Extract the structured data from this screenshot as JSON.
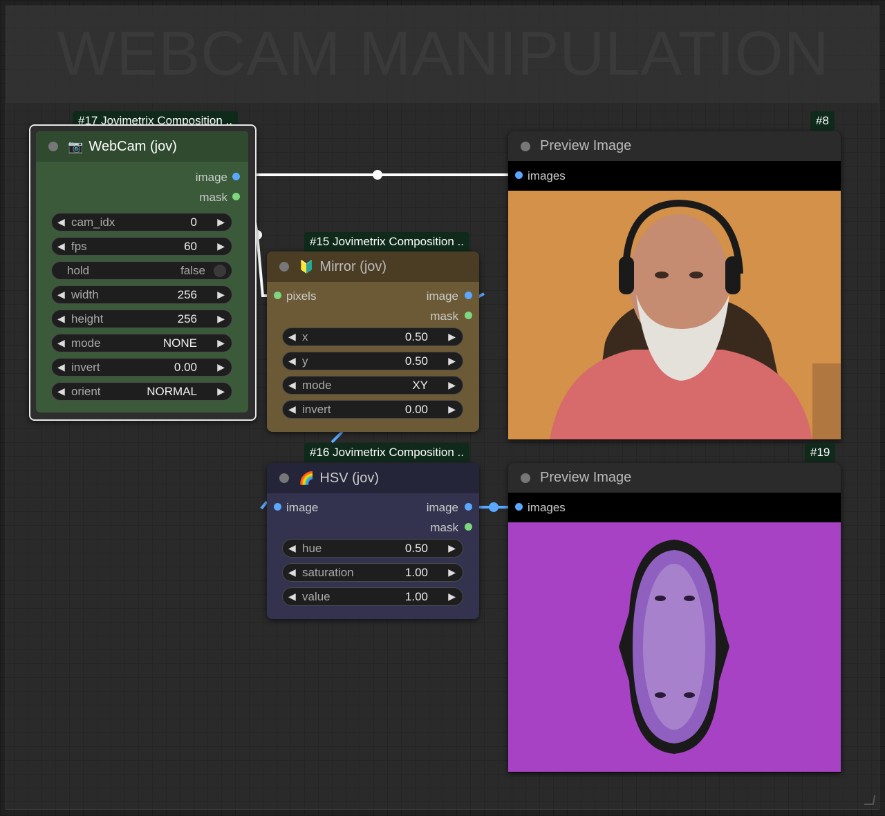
{
  "group": {
    "title": "WEBCAM MANIPULATION"
  },
  "nodes": {
    "webcam": {
      "badge": "#17 Jovimetrix Composition ..",
      "title": "WebCam (jov)",
      "icon": "camera-icon",
      "outputs": [
        "image",
        "mask"
      ],
      "widgets": [
        {
          "label": "cam_idx",
          "value": "0"
        },
        {
          "label": "fps",
          "value": "60"
        },
        {
          "label": "hold",
          "value": "false",
          "toggle": true
        },
        {
          "label": "width",
          "value": "256"
        },
        {
          "label": "height",
          "value": "256"
        },
        {
          "label": "mode",
          "value": "NONE"
        },
        {
          "label": "invert",
          "value": "0.00"
        },
        {
          "label": "orient",
          "value": "NORMAL"
        }
      ]
    },
    "mirror": {
      "badge": "#15 Jovimetrix Composition ..",
      "title": "Mirror (jov)",
      "icon": "beginner-badge-icon",
      "input": "pixels",
      "outputs": [
        "image",
        "mask"
      ],
      "widgets": [
        {
          "label": "x",
          "value": "0.50"
        },
        {
          "label": "y",
          "value": "0.50"
        },
        {
          "label": "mode",
          "value": "XY"
        },
        {
          "label": "invert",
          "value": "0.00"
        }
      ]
    },
    "hsv": {
      "badge": "#16 Jovimetrix Composition ..",
      "title": "HSV (jov)",
      "icon": "rainbow-icon",
      "input": "image",
      "outputs": [
        "image",
        "mask"
      ],
      "widgets": [
        {
          "label": "hue",
          "value": "0.50"
        },
        {
          "label": "saturation",
          "value": "1.00"
        },
        {
          "label": "value",
          "value": "1.00"
        }
      ]
    },
    "preview8": {
      "badge": "#8",
      "title": "Preview Image",
      "input": "images"
    },
    "preview19": {
      "badge": "#19",
      "title": "Preview Image",
      "input": "images"
    }
  },
  "colors": {
    "webcam_node": "#3a5a3a",
    "mirror_node": "#6b5a35",
    "hsv_node": "#33334f",
    "link_image": "#5aa8ff"
  }
}
